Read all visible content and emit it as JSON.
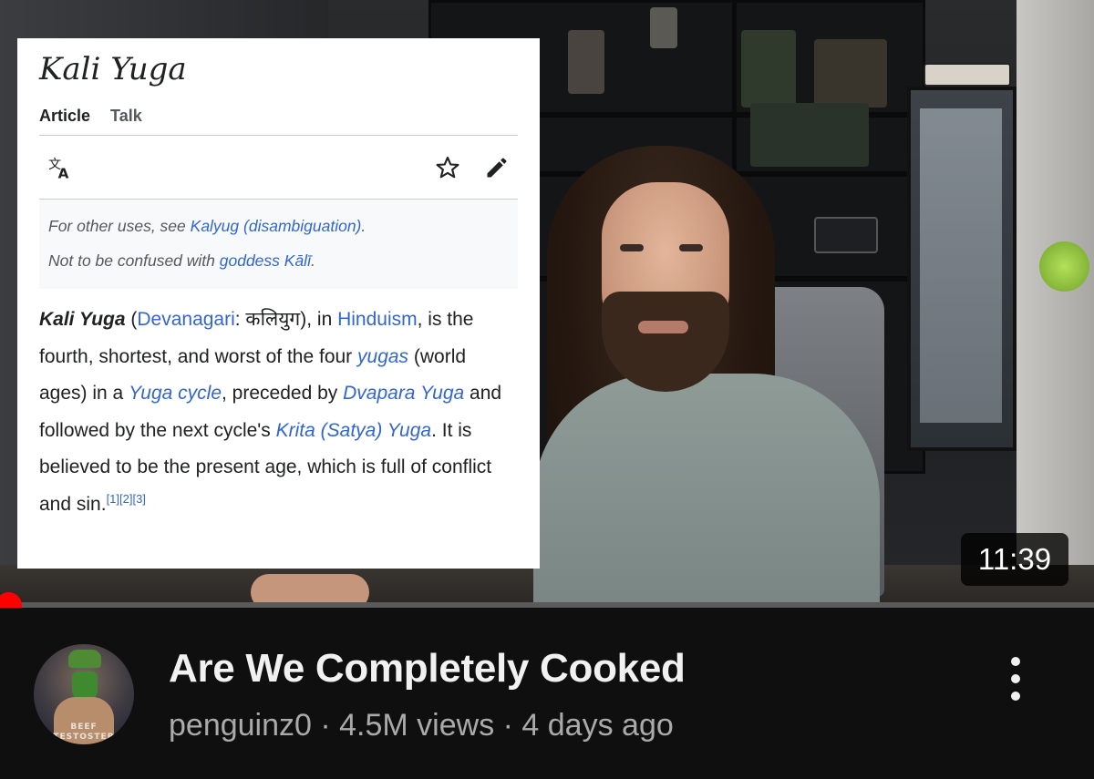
{
  "wiki": {
    "title": "Kali Yuga",
    "tabs": [
      "Article",
      "Talk"
    ],
    "hatnote": {
      "line1_prefix": "For other uses, see ",
      "line1_link": "Kalyug (disambiguation)",
      "line1_suffix": ".",
      "line2_prefix": "Not to be confused with ",
      "line2_link": "goddess Kālī",
      "line2_suffix": "."
    },
    "body": {
      "bold_term": "Kali Yuga",
      "p1": " (",
      "link_devanagari": "Devanagari",
      "p2": ": कलियुग), in ",
      "link_hinduism": "Hinduism",
      "p3": ", is the fourth, shortest, and worst of the four ",
      "link_yugas": "yugas",
      "p4": " (world ages) in a ",
      "link_yuga_cycle": "Yuga cycle",
      "p5": ", preceded by ",
      "link_dvapara": "Dvapara Yuga",
      "p6": " and followed by the next cycle's ",
      "link_krita": "Krita (Satya) Yuga",
      "p7": ". It is believed to be the present age, which is full of conflict and sin.",
      "refs": "[1][2][3]"
    },
    "icons": [
      "translate-icon",
      "star-icon",
      "edit-pencil-icon"
    ]
  },
  "video": {
    "duration": "11:39",
    "progress_fraction": 0.01,
    "title": "Are We Completely Cooked",
    "channel": "penguinz0",
    "views": "4.5M views",
    "age": "4 days ago",
    "separator": " · ",
    "avatar_text_top": "BEEF",
    "avatar_text_bottom": "TESTOSTER"
  },
  "colors": {
    "link": "#3366cc",
    "progress": "#ff0000",
    "background": "#0f0f0f"
  }
}
